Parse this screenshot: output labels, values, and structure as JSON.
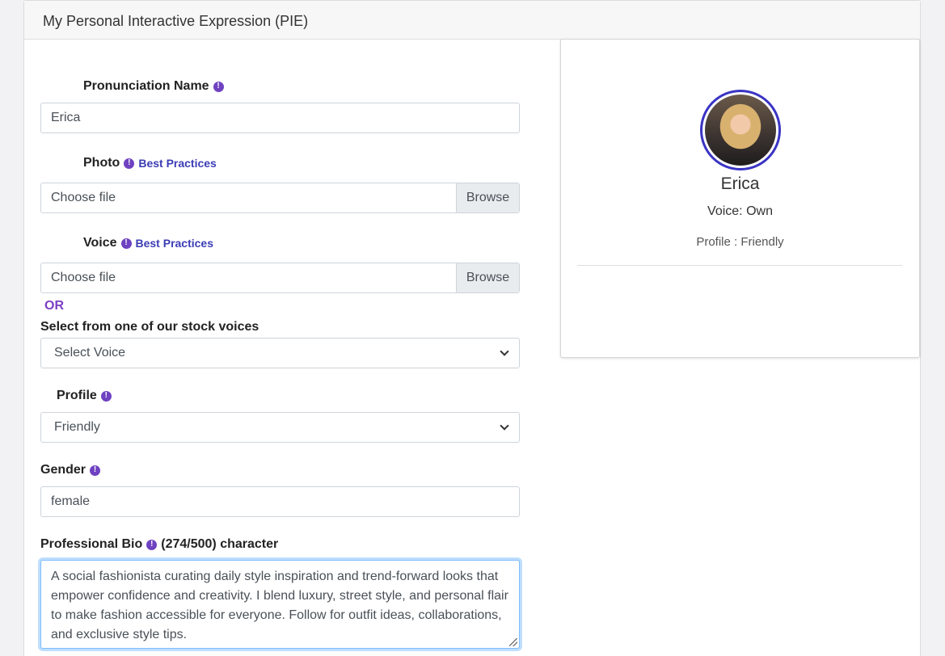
{
  "header": {
    "title": "My Personal Interactive Expression (PIE)"
  },
  "form": {
    "pronunciation": {
      "label": "Pronunciation Name",
      "value": "Erica"
    },
    "photo": {
      "label": "Photo",
      "link": "Best Practices",
      "file_text": "Choose file",
      "browse": "Browse"
    },
    "voice": {
      "label": "Voice",
      "link": "Best Practices",
      "file_text": "Choose file",
      "browse": "Browse"
    },
    "or_text": "OR",
    "stock_voice": {
      "label": "Select from one of our stock voices",
      "selected": "Select Voice"
    },
    "profile": {
      "label": "Profile",
      "selected": "Friendly"
    },
    "gender": {
      "label": "Gender",
      "value": "female"
    },
    "bio": {
      "label": "Professional Bio",
      "count": "(274/500) character",
      "value": "A social fashionista curating daily style inspiration and trend-forward looks that empower confidence and creativity. I blend luxury, street style, and personal flair to make fashion accessible for everyone. Follow for outfit ideas, collaborations, and exclusive style tips."
    }
  },
  "preview": {
    "name": "Erica",
    "voice": "Voice: Own",
    "profile": "Profile : Friendly"
  },
  "icons": {
    "info": "info-icon",
    "avatar": "avatar-photo",
    "chevron": "chevron-down-icon"
  },
  "info_glyph": "!",
  "colors": {
    "accent": "#6f42c1",
    "link": "#3b3cb5",
    "avatar_border": "#3a34c4",
    "focus": "#80bdff"
  }
}
